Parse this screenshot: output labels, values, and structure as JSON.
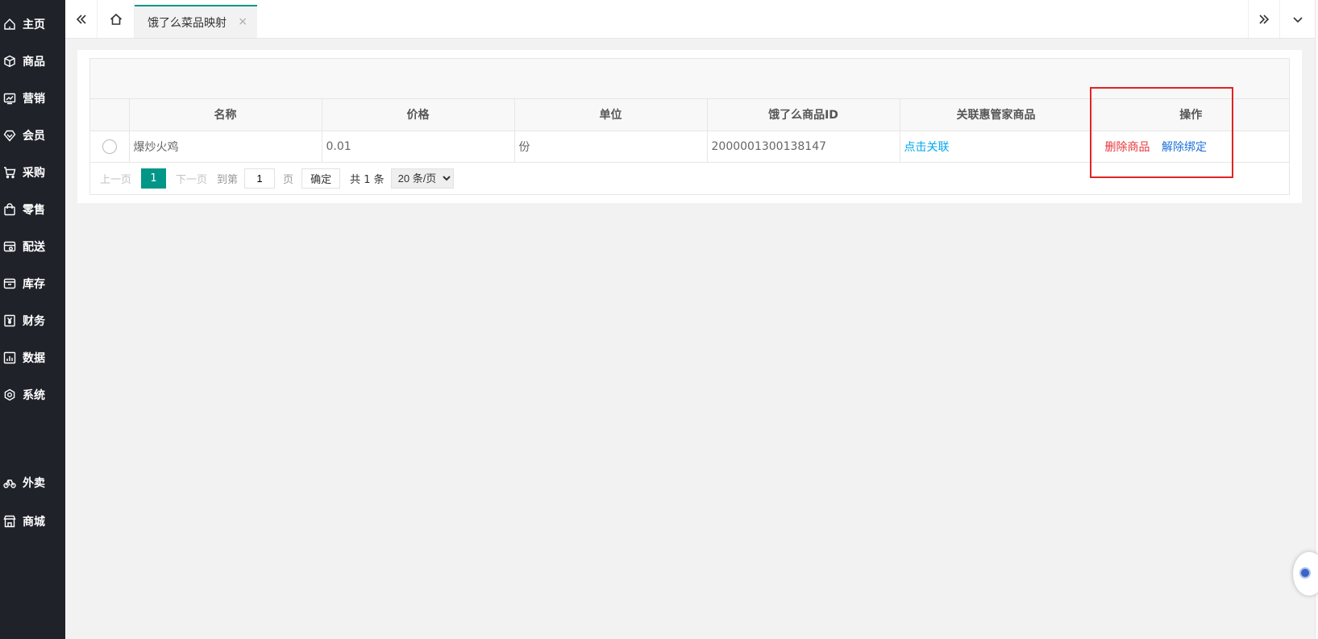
{
  "sidebar": {
    "items": [
      {
        "label": "主页",
        "icon": "home-icon"
      },
      {
        "label": "商品",
        "icon": "box-icon"
      },
      {
        "label": "营销",
        "icon": "chart-icon"
      },
      {
        "label": "会员",
        "icon": "diamond-icon"
      },
      {
        "label": "采购",
        "icon": "cart-icon"
      },
      {
        "label": "零售",
        "icon": "bag-icon"
      },
      {
        "label": "配送",
        "icon": "delivery-icon"
      },
      {
        "label": "库存",
        "icon": "archive-icon"
      },
      {
        "label": "财务",
        "icon": "yen-icon"
      },
      {
        "label": "数据",
        "icon": "bars-icon"
      },
      {
        "label": "系统",
        "icon": "settings-icon"
      },
      {
        "label": "外卖",
        "icon": "bike-icon"
      },
      {
        "label": "商城",
        "icon": "store-icon"
      }
    ]
  },
  "tabs": {
    "active": {
      "label": "饿了么菜品映射",
      "close": "×"
    }
  },
  "table": {
    "columns": [
      "名称",
      "价格",
      "单位",
      "饿了么商品ID",
      "关联惠管家商品",
      "操作"
    ],
    "rows": [
      {
        "name": "爆炒火鸡",
        "price": "0.01",
        "unit": "份",
        "eleme_id": "2000001300138147",
        "link_action": "点击关联",
        "delete_action": "删除商品",
        "unbind_action": "解除绑定"
      }
    ]
  },
  "pager": {
    "prev": "上一页",
    "current": "1",
    "next": "下一页",
    "goto_label": "到第",
    "goto_value": "1",
    "page_unit": "页",
    "confirm": "确定",
    "total": "共 1 条",
    "page_size": "20 条/页"
  },
  "colors": {
    "sidebar_bg": "#20222a",
    "accent": "#009688",
    "highlight_box": "#e02424",
    "link_cyan": "#01aaed",
    "danger": "#e8353b",
    "link_blue": "#1e70d8"
  }
}
